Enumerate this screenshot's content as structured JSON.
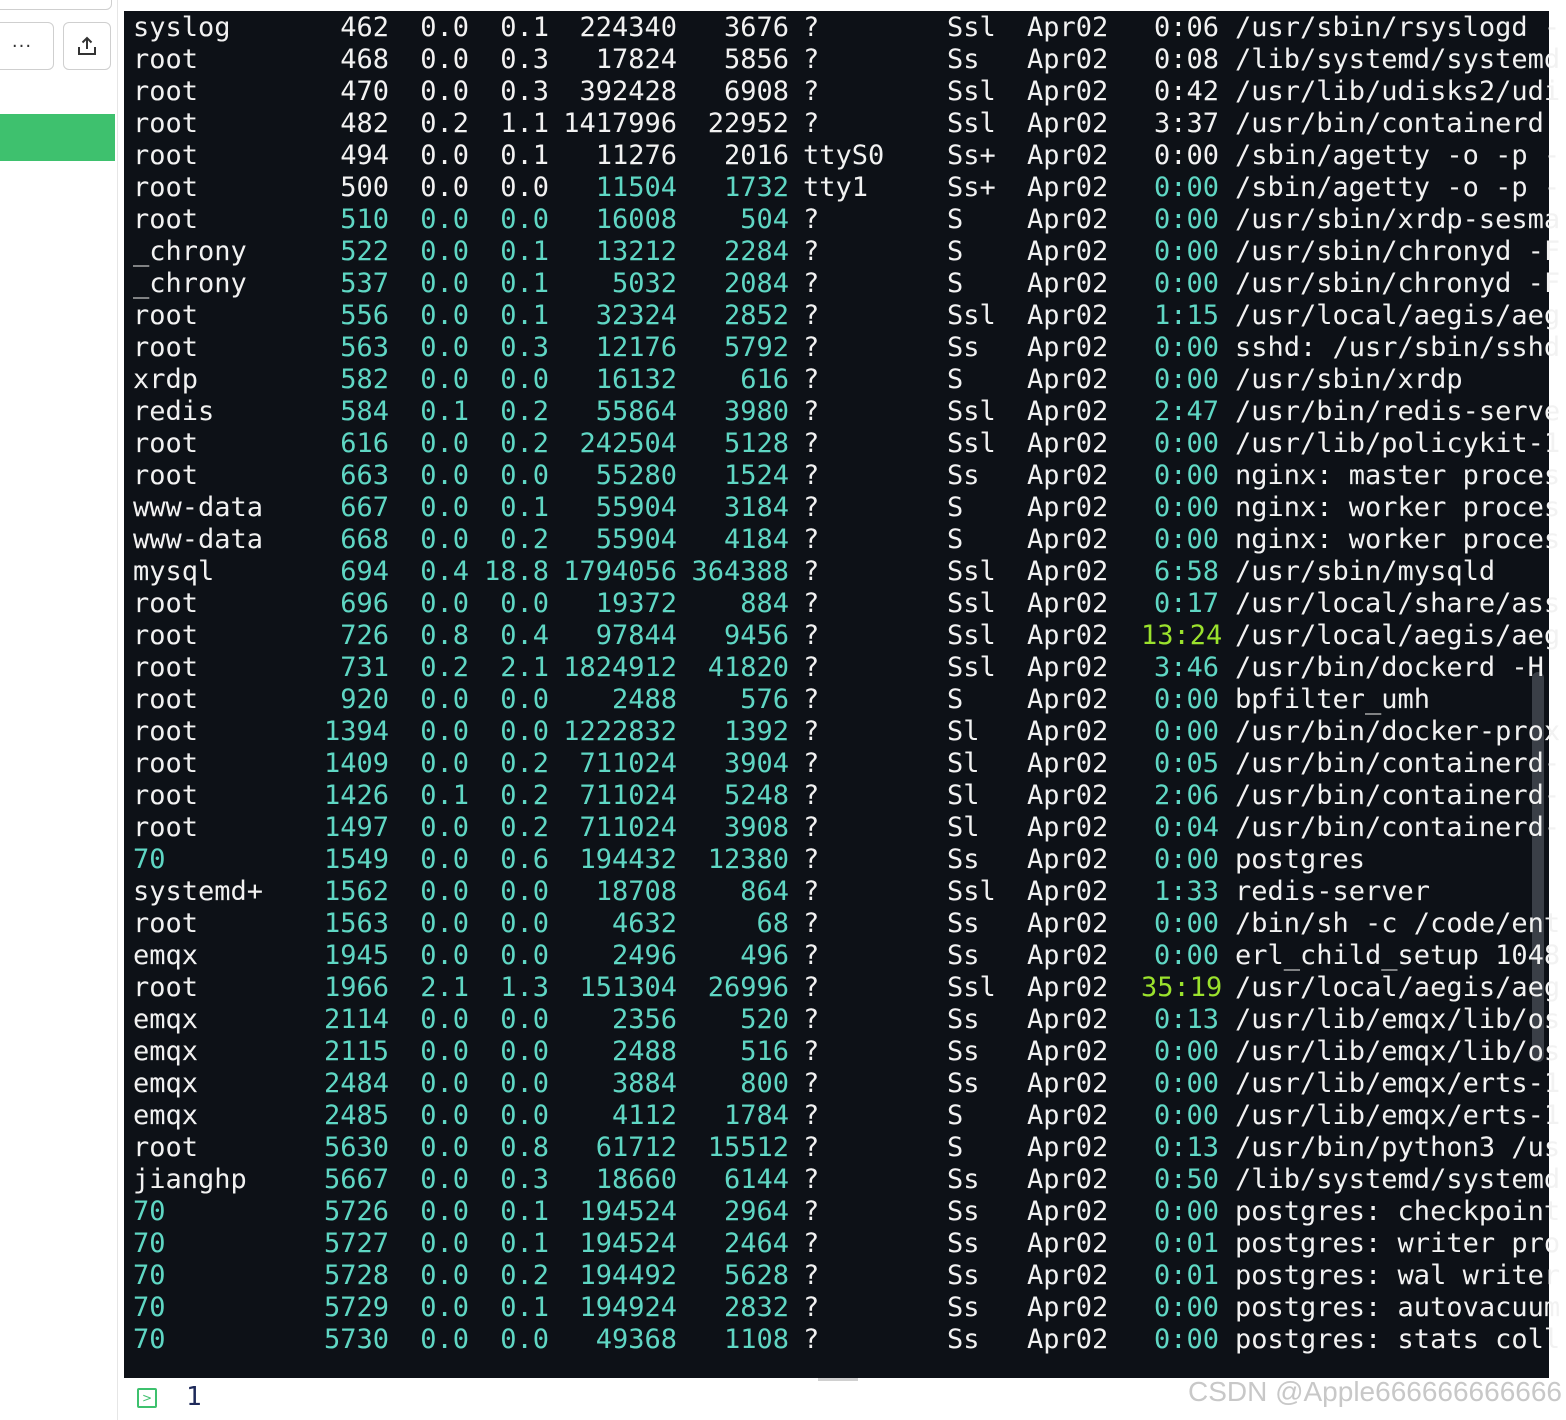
{
  "toolbar": {
    "more_label": "···",
    "share_icon": "share-icon"
  },
  "colors": {
    "terminal_bg": "#0d1117",
    "white_text": "#f2f2f2",
    "cyan_text": "#5fd7c4",
    "lime_text": "#9be22d",
    "green_accent": "#3ec16e"
  },
  "rows": [
    {
      "user": "syslog",
      "pid": "462",
      "cpu": "0.0",
      "mem": "0.1",
      "vsz": "224340",
      "rss": "3676",
      "tty": "?",
      "stat": "Ssl",
      "start": "Apr02",
      "time": "0:06",
      "cmd": "/usr/sbin/rsyslogd -",
      "color": "white"
    },
    {
      "user": "root",
      "pid": "468",
      "cpu": "0.0",
      "mem": "0.3",
      "vsz": "17824",
      "rss": "5856",
      "tty": "?",
      "stat": "Ss",
      "start": "Apr02",
      "time": "0:08",
      "cmd": "/lib/systemd/systemd",
      "color": "white"
    },
    {
      "user": "root",
      "pid": "470",
      "cpu": "0.0",
      "mem": "0.3",
      "vsz": "392428",
      "rss": "6908",
      "tty": "?",
      "stat": "Ssl",
      "start": "Apr02",
      "time": "0:42",
      "cmd": "/usr/lib/udisks2/udi",
      "color": "white"
    },
    {
      "user": "root",
      "pid": "482",
      "cpu": "0.2",
      "mem": "1.1",
      "vsz": "1417996",
      "rss": "22952",
      "tty": "?",
      "stat": "Ssl",
      "start": "Apr02",
      "time": "3:37",
      "cmd": "/usr/bin/containerd",
      "color": "white"
    },
    {
      "user": "root",
      "pid": "494",
      "cpu": "0.0",
      "mem": "0.1",
      "vsz": "11276",
      "rss": "2016",
      "tty": "ttyS0",
      "stat": "Ss+",
      "start": "Apr02",
      "time": "0:00",
      "cmd": "/sbin/agetty -o -p -",
      "color": "white"
    },
    {
      "user": "root",
      "pid": "500",
      "cpu": "0.0",
      "mem": "0.0",
      "vsz": "11504",
      "rss": "1732",
      "tty": "tty1",
      "stat": "Ss+",
      "start": "Apr02",
      "time": "0:00",
      "cmd": "/sbin/agetty -o -p -",
      "color": "partial"
    },
    {
      "user": "root",
      "pid": "510",
      "cpu": "0.0",
      "mem": "0.0",
      "vsz": "16008",
      "rss": "504",
      "tty": "?",
      "stat": "S",
      "start": "Apr02",
      "time": "0:00",
      "cmd": "/usr/sbin/xrdp-sesma",
      "color": "cyan"
    },
    {
      "user": "_chrony",
      "pid": "522",
      "cpu": "0.0",
      "mem": "0.1",
      "vsz": "13212",
      "rss": "2284",
      "tty": "?",
      "stat": "S",
      "start": "Apr02",
      "time": "0:00",
      "cmd": "/usr/sbin/chronyd -F",
      "color": "cyan"
    },
    {
      "user": "_chrony",
      "pid": "537",
      "cpu": "0.0",
      "mem": "0.1",
      "vsz": "5032",
      "rss": "2084",
      "tty": "?",
      "stat": "S",
      "start": "Apr02",
      "time": "0:00",
      "cmd": "/usr/sbin/chronyd -F",
      "color": "cyan"
    },
    {
      "user": "root",
      "pid": "556",
      "cpu": "0.0",
      "mem": "0.1",
      "vsz": "32324",
      "rss": "2852",
      "tty": "?",
      "stat": "Ssl",
      "start": "Apr02",
      "time": "1:15",
      "cmd": "/usr/local/aegis/aeg",
      "color": "cyan"
    },
    {
      "user": "root",
      "pid": "563",
      "cpu": "0.0",
      "mem": "0.3",
      "vsz": "12176",
      "rss": "5792",
      "tty": "?",
      "stat": "Ss",
      "start": "Apr02",
      "time": "0:00",
      "cmd": "sshd: /usr/sbin/sshd",
      "color": "cyan"
    },
    {
      "user": "xrdp",
      "pid": "582",
      "cpu": "0.0",
      "mem": "0.0",
      "vsz": "16132",
      "rss": "616",
      "tty": "?",
      "stat": "S",
      "start": "Apr02",
      "time": "0:00",
      "cmd": "/usr/sbin/xrdp",
      "color": "cyan"
    },
    {
      "user": "redis",
      "pid": "584",
      "cpu": "0.1",
      "mem": "0.2",
      "vsz": "55864",
      "rss": "3980",
      "tty": "?",
      "stat": "Ssl",
      "start": "Apr02",
      "time": "2:47",
      "cmd": "/usr/bin/redis-serve",
      "color": "cyan"
    },
    {
      "user": "root",
      "pid": "616",
      "cpu": "0.0",
      "mem": "0.2",
      "vsz": "242504",
      "rss": "5128",
      "tty": "?",
      "stat": "Ssl",
      "start": "Apr02",
      "time": "0:00",
      "cmd": "/usr/lib/policykit-1",
      "color": "cyan"
    },
    {
      "user": "root",
      "pid": "663",
      "cpu": "0.0",
      "mem": "0.0",
      "vsz": "55280",
      "rss": "1524",
      "tty": "?",
      "stat": "Ss",
      "start": "Apr02",
      "time": "0:00",
      "cmd": "nginx: master proces",
      "color": "cyan"
    },
    {
      "user": "www-data",
      "pid": "667",
      "cpu": "0.0",
      "mem": "0.1",
      "vsz": "55904",
      "rss": "3184",
      "tty": "?",
      "stat": "S",
      "start": "Apr02",
      "time": "0:00",
      "cmd": "nginx: worker proces",
      "color": "cyan"
    },
    {
      "user": "www-data",
      "pid": "668",
      "cpu": "0.0",
      "mem": "0.2",
      "vsz": "55904",
      "rss": "4184",
      "tty": "?",
      "stat": "S",
      "start": "Apr02",
      "time": "0:00",
      "cmd": "nginx: worker proces",
      "color": "cyan"
    },
    {
      "user": "mysql",
      "pid": "694",
      "cpu": "0.4",
      "mem": "18.8",
      "vsz": "1794056",
      "rss": "364388",
      "tty": "?",
      "stat": "Ssl",
      "start": "Apr02",
      "time": "6:58",
      "cmd": "/usr/sbin/mysqld",
      "color": "cyan"
    },
    {
      "user": "root",
      "pid": "696",
      "cpu": "0.0",
      "mem": "0.0",
      "vsz": "19372",
      "rss": "884",
      "tty": "?",
      "stat": "Ssl",
      "start": "Apr02",
      "time": "0:17",
      "cmd": "/usr/local/share/ass",
      "color": "cyan"
    },
    {
      "user": "root",
      "pid": "726",
      "cpu": "0.8",
      "mem": "0.4",
      "vsz": "97844",
      "rss": "9456",
      "tty": "?",
      "stat": "Ssl",
      "start": "Apr02",
      "time": "13:24",
      "cmd": "/usr/local/aegis/aeg",
      "color": "cyan",
      "time_hot": true
    },
    {
      "user": "root",
      "pid": "731",
      "cpu": "0.2",
      "mem": "2.1",
      "vsz": "1824912",
      "rss": "41820",
      "tty": "?",
      "stat": "Ssl",
      "start": "Apr02",
      "time": "3:46",
      "cmd": "/usr/bin/dockerd -H",
      "color": "cyan"
    },
    {
      "user": "root",
      "pid": "920",
      "cpu": "0.0",
      "mem": "0.0",
      "vsz": "2488",
      "rss": "576",
      "tty": "?",
      "stat": "S",
      "start": "Apr02",
      "time": "0:00",
      "cmd": "bpfilter_umh",
      "color": "cyan"
    },
    {
      "user": "root",
      "pid": "1394",
      "cpu": "0.0",
      "mem": "0.0",
      "vsz": "1222832",
      "rss": "1392",
      "tty": "?",
      "stat": "Sl",
      "start": "Apr02",
      "time": "0:00",
      "cmd": "/usr/bin/docker-prox",
      "color": "cyan"
    },
    {
      "user": "root",
      "pid": "1409",
      "cpu": "0.0",
      "mem": "0.2",
      "vsz": "711024",
      "rss": "3904",
      "tty": "?",
      "stat": "Sl",
      "start": "Apr02",
      "time": "0:05",
      "cmd": "/usr/bin/containerd-",
      "color": "cyan"
    },
    {
      "user": "root",
      "pid": "1426",
      "cpu": "0.1",
      "mem": "0.2",
      "vsz": "711024",
      "rss": "5248",
      "tty": "?",
      "stat": "Sl",
      "start": "Apr02",
      "time": "2:06",
      "cmd": "/usr/bin/containerd-",
      "color": "cyan"
    },
    {
      "user": "root",
      "pid": "1497",
      "cpu": "0.0",
      "mem": "0.2",
      "vsz": "711024",
      "rss": "3908",
      "tty": "?",
      "stat": "Sl",
      "start": "Apr02",
      "time": "0:04",
      "cmd": "/usr/bin/containerd-",
      "color": "cyan"
    },
    {
      "user": "70",
      "pid": "1549",
      "cpu": "0.0",
      "mem": "0.6",
      "vsz": "194432",
      "rss": "12380",
      "tty": "?",
      "stat": "Ss",
      "start": "Apr02",
      "time": "0:00",
      "cmd": "postgres",
      "color": "cyan",
      "user_cyan": true
    },
    {
      "user": "systemd+",
      "pid": "1562",
      "cpu": "0.0",
      "mem": "0.0",
      "vsz": "18708",
      "rss": "864",
      "tty": "?",
      "stat": "Ssl",
      "start": "Apr02",
      "time": "1:33",
      "cmd": "redis-server",
      "color": "cyan"
    },
    {
      "user": "root",
      "pid": "1563",
      "cpu": "0.0",
      "mem": "0.0",
      "vsz": "4632",
      "rss": "68",
      "tty": "?",
      "stat": "Ss",
      "start": "Apr02",
      "time": "0:00",
      "cmd": "/bin/sh -c /code/ent",
      "color": "cyan"
    },
    {
      "user": "emqx",
      "pid": "1945",
      "cpu": "0.0",
      "mem": "0.0",
      "vsz": "2496",
      "rss": "496",
      "tty": "?",
      "stat": "Ss",
      "start": "Apr02",
      "time": "0:00",
      "cmd": "erl_child_setup 1048",
      "color": "cyan"
    },
    {
      "user": "root",
      "pid": "1966",
      "cpu": "2.1",
      "mem": "1.3",
      "vsz": "151304",
      "rss": "26996",
      "tty": "?",
      "stat": "Ssl",
      "start": "Apr02",
      "time": "35:19",
      "cmd": "/usr/local/aegis/aeg",
      "color": "cyan",
      "time_hot": true
    },
    {
      "user": "emqx",
      "pid": "2114",
      "cpu": "0.0",
      "mem": "0.0",
      "vsz": "2356",
      "rss": "520",
      "tty": "?",
      "stat": "Ss",
      "start": "Apr02",
      "time": "0:13",
      "cmd": "/usr/lib/emqx/lib/os",
      "color": "cyan"
    },
    {
      "user": "emqx",
      "pid": "2115",
      "cpu": "0.0",
      "mem": "0.0",
      "vsz": "2488",
      "rss": "516",
      "tty": "?",
      "stat": "Ss",
      "start": "Apr02",
      "time": "0:00",
      "cmd": "/usr/lib/emqx/lib/os",
      "color": "cyan"
    },
    {
      "user": "emqx",
      "pid": "2484",
      "cpu": "0.0",
      "mem": "0.0",
      "vsz": "3884",
      "rss": "800",
      "tty": "?",
      "stat": "Ss",
      "start": "Apr02",
      "time": "0:00",
      "cmd": "/usr/lib/emqx/erts-1",
      "color": "cyan"
    },
    {
      "user": "emqx",
      "pid": "2485",
      "cpu": "0.0",
      "mem": "0.0",
      "vsz": "4112",
      "rss": "1784",
      "tty": "?",
      "stat": "S",
      "start": "Apr02",
      "time": "0:00",
      "cmd": "/usr/lib/emqx/erts-1",
      "color": "cyan"
    },
    {
      "user": "root",
      "pid": "5630",
      "cpu": "0.0",
      "mem": "0.8",
      "vsz": "61712",
      "rss": "15512",
      "tty": "?",
      "stat": "S",
      "start": "Apr02",
      "time": "0:13",
      "cmd": "/usr/bin/python3 /us",
      "color": "cyan"
    },
    {
      "user": "jianghp",
      "pid": "5667",
      "cpu": "0.0",
      "mem": "0.3",
      "vsz": "18660",
      "rss": "6144",
      "tty": "?",
      "stat": "Ss",
      "start": "Apr02",
      "time": "0:50",
      "cmd": "/lib/systemd/systemd",
      "color": "cyan"
    },
    {
      "user": "70",
      "pid": "5726",
      "cpu": "0.0",
      "mem": "0.1",
      "vsz": "194524",
      "rss": "2964",
      "tty": "?",
      "stat": "Ss",
      "start": "Apr02",
      "time": "0:00",
      "cmd": "postgres: checkpoint",
      "color": "cyan",
      "user_cyan": true
    },
    {
      "user": "70",
      "pid": "5727",
      "cpu": "0.0",
      "mem": "0.1",
      "vsz": "194524",
      "rss": "2464",
      "tty": "?",
      "stat": "Ss",
      "start": "Apr02",
      "time": "0:01",
      "cmd": "postgres: writer pro",
      "color": "cyan",
      "user_cyan": true
    },
    {
      "user": "70",
      "pid": "5728",
      "cpu": "0.0",
      "mem": "0.2",
      "vsz": "194492",
      "rss": "5628",
      "tty": "?",
      "stat": "Ss",
      "start": "Apr02",
      "time": "0:01",
      "cmd": "postgres: wal writer",
      "color": "cyan",
      "user_cyan": true
    },
    {
      "user": "70",
      "pid": "5729",
      "cpu": "0.0",
      "mem": "0.1",
      "vsz": "194924",
      "rss": "2832",
      "tty": "?",
      "stat": "Ss",
      "start": "Apr02",
      "time": "0:00",
      "cmd": "postgres: autovacuum",
      "color": "cyan",
      "user_cyan": true
    },
    {
      "user": "70",
      "pid": "5730",
      "cpu": "0.0",
      "mem": "0.0",
      "vsz": "49368",
      "rss": "1108",
      "tty": "?",
      "stat": "Ss",
      "start": "Apr02",
      "time": "0:00",
      "cmd": "postgres: stats coll",
      "color": "cyan",
      "user_cyan": true
    }
  ],
  "editor": {
    "line_number": "1"
  },
  "watermark": "CSDN @Apple666666666666"
}
